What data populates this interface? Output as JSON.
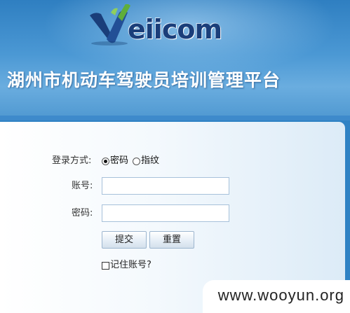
{
  "header": {
    "logo_text": "eiicom",
    "platform_title": "湖州市机动车驾驶员培训管理平台",
    "colors": {
      "brand_dark": "#1a3e7a",
      "brand_green": "#5fae3a",
      "header_blue": "#3f8ccc"
    }
  },
  "login_form": {
    "method_label": "登录方式:",
    "method_options": [
      {
        "label": "密码",
        "checked": true
      },
      {
        "label": "指纹",
        "checked": false
      }
    ],
    "account_label": "账号:",
    "account_value": "",
    "password_label": "密码:",
    "password_value": "",
    "submit_label": "提交",
    "reset_label": "重置",
    "remember_label": "记住账号?",
    "remember_checked": false
  },
  "watermark": {
    "text": "www.wooyun.org"
  }
}
